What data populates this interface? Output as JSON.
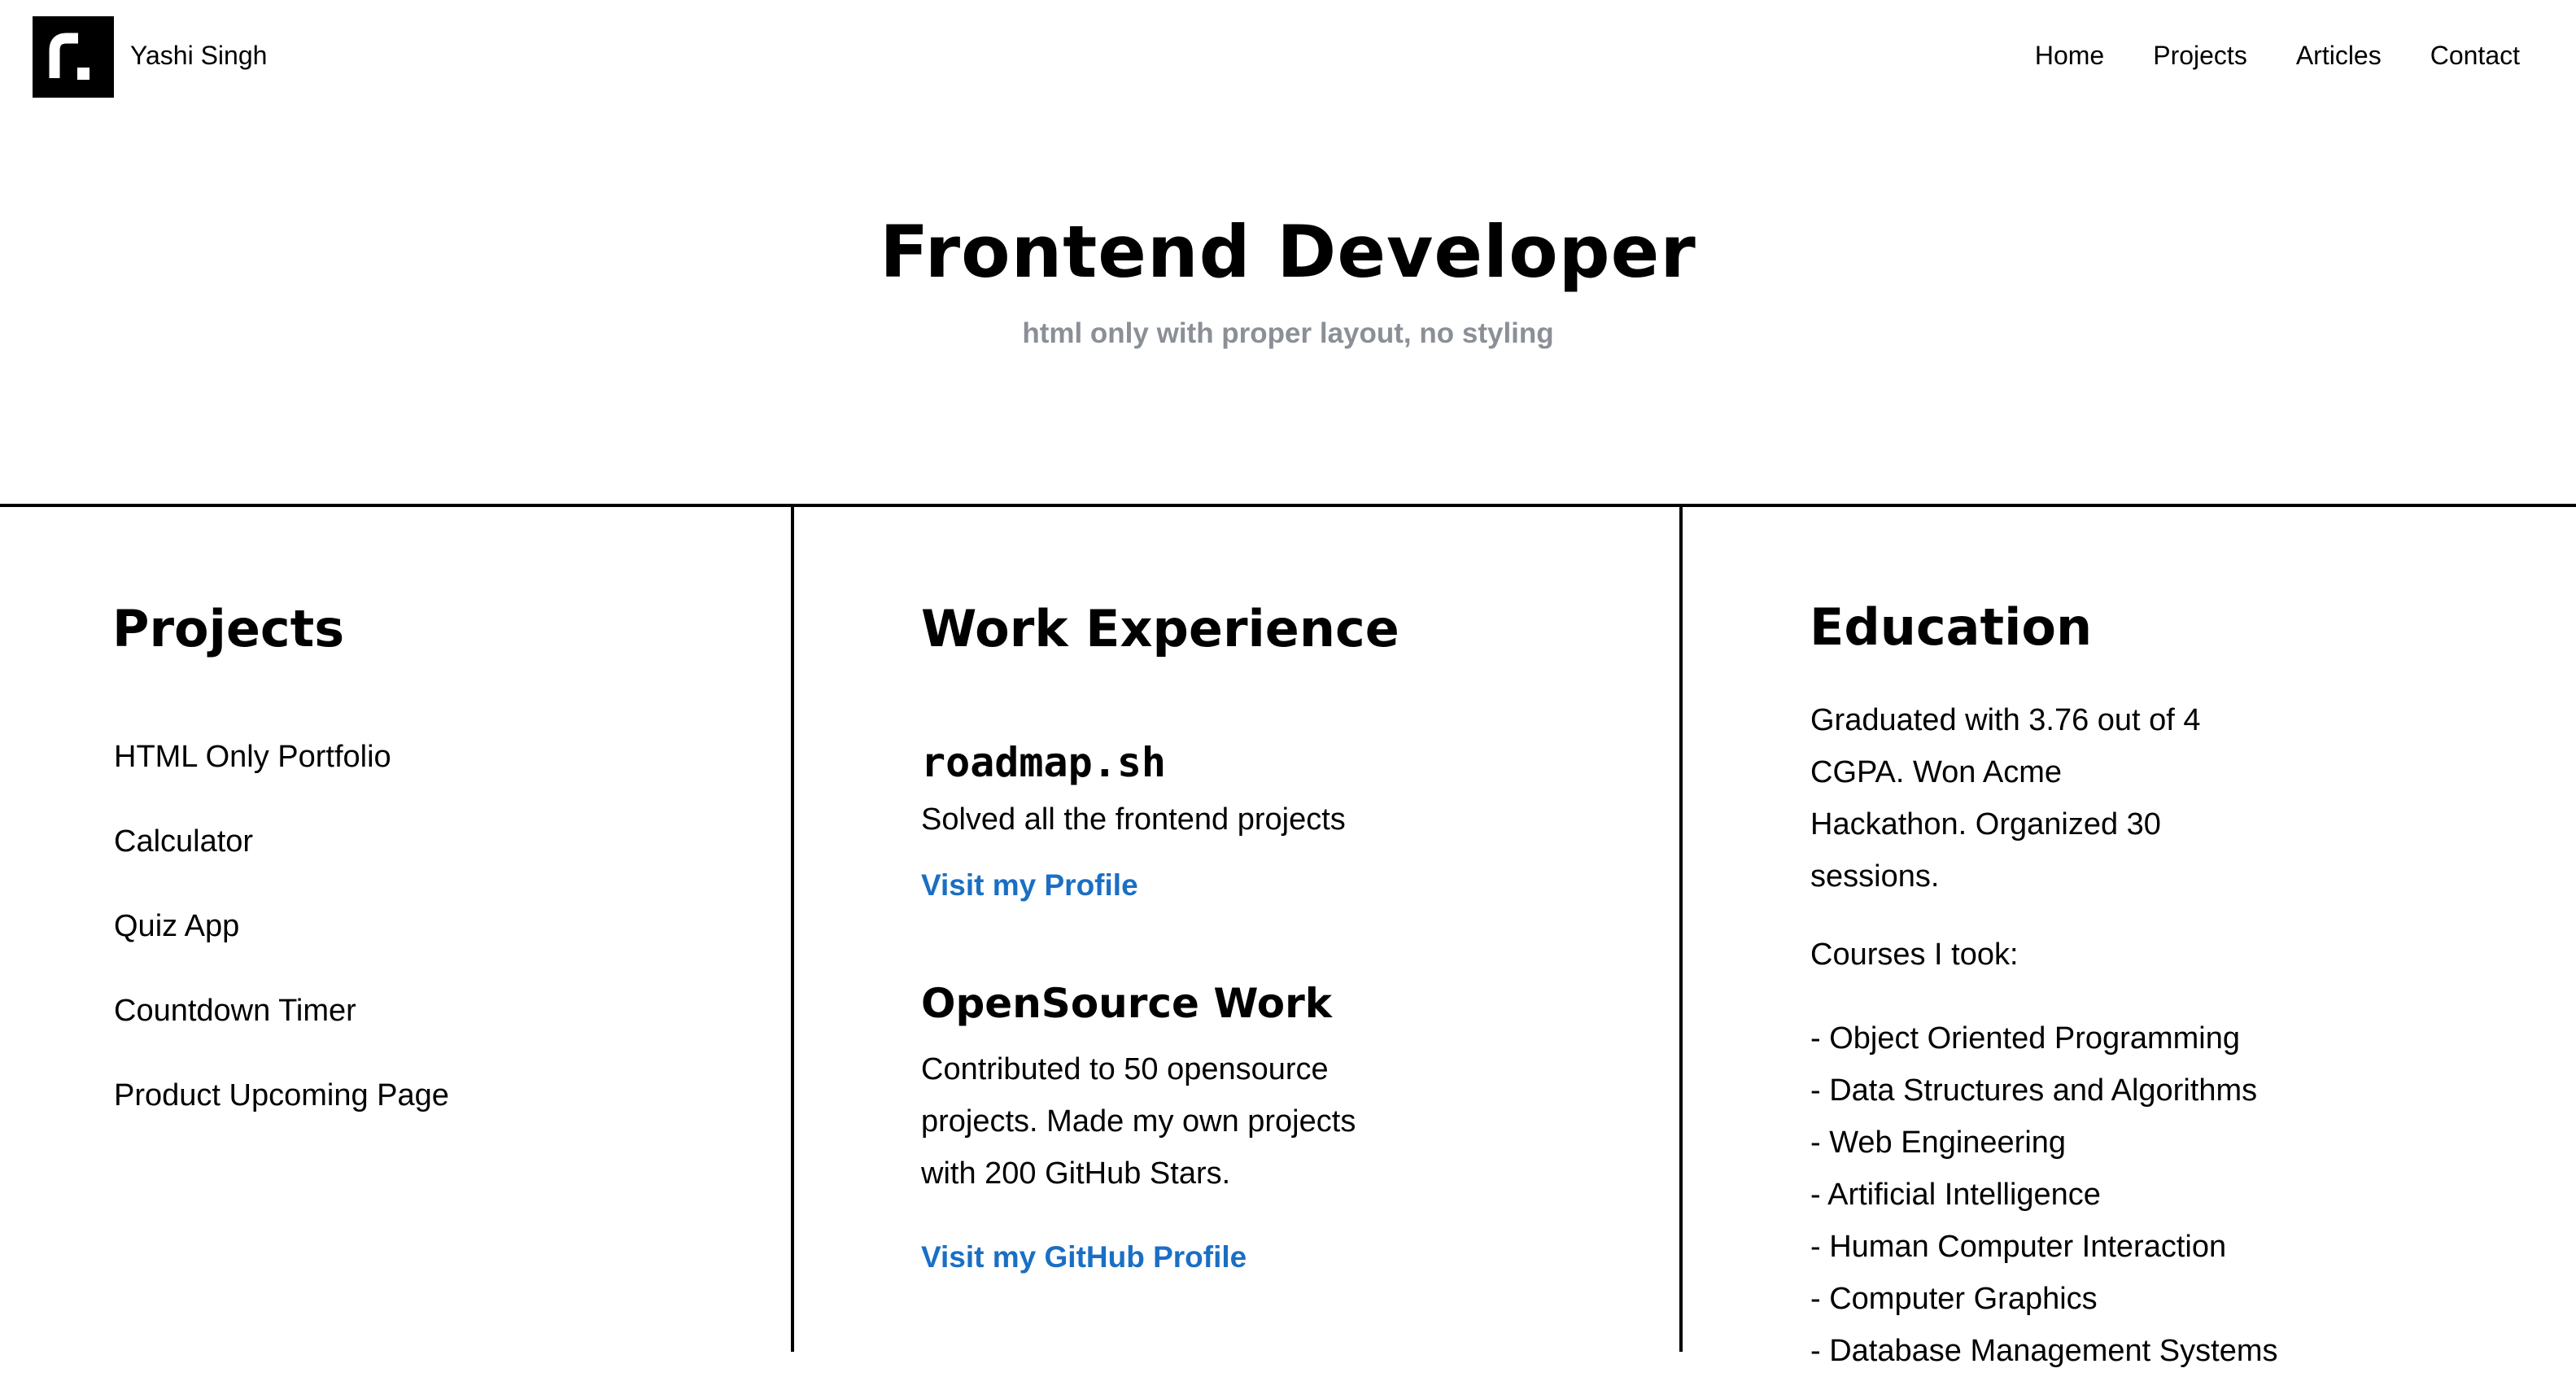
{
  "header": {
    "brand_name": "Yashi Singh",
    "logo_icon": "roadmap-r-icon",
    "nav": [
      "Home",
      "Projects",
      "Articles",
      "Contact"
    ]
  },
  "hero": {
    "title": "Frontend Developer",
    "subtitle": "html only with proper layout, no styling"
  },
  "projects": {
    "title": "Projects",
    "items": [
      "HTML Only Portfolio",
      "Calculator",
      "Quiz App",
      "Countdown Timer",
      "Product Upcoming Page"
    ]
  },
  "work": {
    "title": "Work Experience",
    "roadmap": {
      "name": "roadmap.sh",
      "description": "Solved all the frontend projects",
      "link": "Visit my Profile"
    },
    "opensource": {
      "name": "OpenSource Work",
      "description_lines": [
        "Contributed to 50 opensource",
        "projects. Made my own projects",
        "with 200 GitHub Stars."
      ],
      "link": "Visit my GitHub Profile"
    }
  },
  "education": {
    "title": "Education",
    "summary_lines": [
      "Graduated with 3.76 out of 4",
      "CGPA. Won Acme",
      "Hackathon. Organized 30",
      "sessions."
    ],
    "courses_label": "Courses I took:",
    "courses": [
      "- Object Oriented Programming",
      "- Data Structures and Algorithms",
      "- Web Engineering",
      "- Artificial Intelligence",
      "- Human Computer Interaction",
      "- Computer Graphics",
      "- Database Management Systems"
    ]
  },
  "colors": {
    "text": "#000000",
    "muted": "#8b8f96",
    "link": "#1a6fc4",
    "background": "#ffffff"
  }
}
